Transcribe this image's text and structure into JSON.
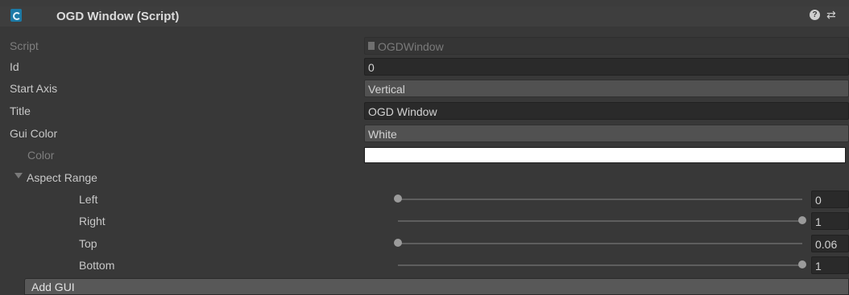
{
  "component": {
    "title": "OGD Window (Script)",
    "icons": [
      "script-icon",
      "help-icon",
      "preset-icon"
    ],
    "help_glyph": "?"
  },
  "fields": {
    "script": {
      "label": "Script",
      "value": "OGDWindow"
    },
    "id": {
      "label": "Id",
      "value": "0"
    },
    "start_axis": {
      "label": "Start Axis",
      "value": "Vertical"
    },
    "title": {
      "label": "Title",
      "value": "OGD Window"
    },
    "gui_color": {
      "label": "Gui Color",
      "value": "White"
    },
    "color": {
      "label": "Color",
      "value": "#ffffff"
    }
  },
  "aspect_range": {
    "label": "Aspect Range",
    "expanded": true,
    "sliders": [
      {
        "label": "Left",
        "value": "0",
        "fraction": 0
      },
      {
        "label": "Right",
        "value": "1",
        "fraction": 1
      },
      {
        "label": "Top",
        "value": "0.06",
        "fraction": 0
      },
      {
        "label": "Bottom",
        "value": "1",
        "fraction": 1
      }
    ]
  },
  "add_button": {
    "label": "Add GUI"
  }
}
